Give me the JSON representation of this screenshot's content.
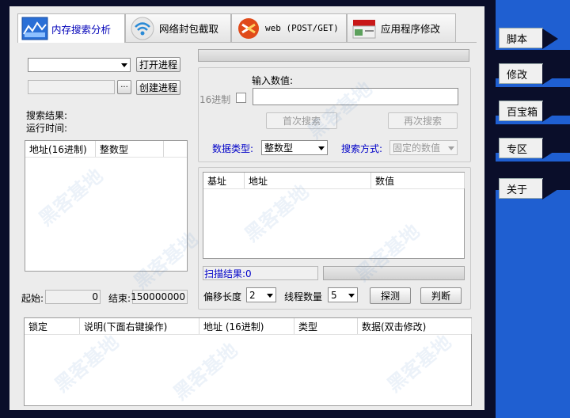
{
  "tabs": [
    {
      "label": "内存搜索分析",
      "icon": "chart-icon"
    },
    {
      "label": "网络封包截取",
      "icon": "wifi-icon"
    },
    {
      "label": "web  (POST/GET)",
      "icon": "web-icon"
    },
    {
      "label": "应用程序修改",
      "icon": "toolbox-icon"
    }
  ],
  "process": {
    "open_button": "打开进程",
    "create_button": "创建进程",
    "browse_button": "···"
  },
  "results": {
    "search_result_label": "搜索结果:",
    "run_time_label": "运行时间:",
    "columns": [
      "地址(16进制)",
      "整数型"
    ]
  },
  "range": {
    "start_label": "起始:",
    "start_value": "0",
    "end_label": "结束:",
    "end_value": "150000000"
  },
  "search": {
    "input_label": "输入数值:",
    "hex_label": "16进制",
    "first_search": "首次搜索",
    "next_search": "再次搜索",
    "data_type_label": "数据类型:",
    "data_type_value": "整数型",
    "search_mode_label": "搜索方式:",
    "search_mode_value": "固定的数值"
  },
  "scan": {
    "columns": [
      "基址",
      "地址",
      "数值"
    ],
    "result_label": "扫描结果:0",
    "offset_label": "偏移长度",
    "offset_value": "2",
    "threads_label": "线程数量",
    "threads_value": "5",
    "probe_button": "探测",
    "judge_button": "判断"
  },
  "locked": {
    "columns": [
      "锁定",
      "说明(下面右键操作)",
      "地址 (16进制)",
      "类型",
      "数据(双击修改)"
    ]
  },
  "sidebar": {
    "items": [
      "脚本",
      "修改",
      "百宝箱",
      "专区",
      "关于"
    ]
  },
  "watermark": "黑客基地",
  "colors": {
    "accent": "#1f5fd1",
    "label_blue": "#0000c8",
    "dark_bg": "#0a0e2a"
  }
}
